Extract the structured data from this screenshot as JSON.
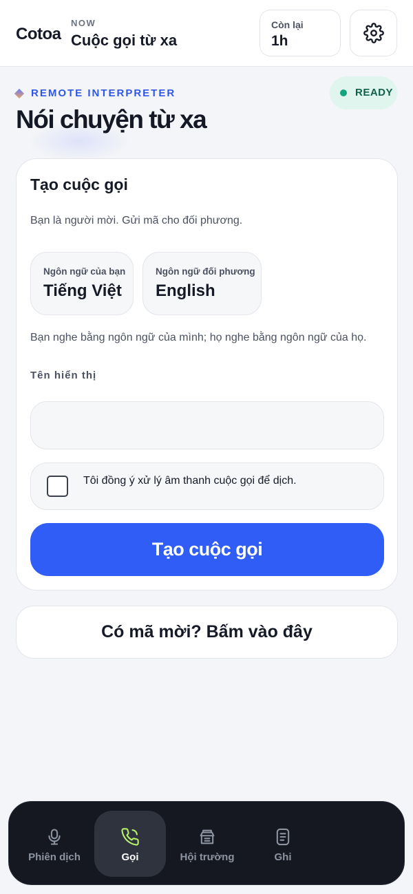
{
  "header": {
    "brand": "Cotoa",
    "now_label": "NOW",
    "title": "Cuộc gọi từ xa",
    "remaining_label": "Còn lại",
    "remaining_value": "1h",
    "settings_icon": "gear-icon"
  },
  "hero": {
    "kicker": "REMOTE INTERPRETER",
    "status": "READY",
    "title": "Nói chuyện từ xa",
    "colors": {
      "accent": "#2f57e8",
      "status_bg": "#dff5ee",
      "status_dot": "#14a37f"
    }
  },
  "create_call": {
    "title": "Tạo cuộc gọi",
    "description": "Bạn là người mời. Gửi mã cho đối phương.",
    "my_language_label": "Ngôn ngữ của bạn",
    "my_language_value": "Tiếng Việt",
    "their_language_label": "Ngôn ngữ đối phương",
    "their_language_value": "English",
    "hint": "Bạn nghe bằng ngôn ngữ của mình; họ nghe bằng ngôn ngữ của họ.",
    "display_name_label": "Tên hiển thị",
    "display_name_value": "",
    "consent_text": "Tôi đồng ý xử lý âm thanh cuộc gọi để dịch.",
    "consent_checked": false,
    "submit_label": "Tạo cuộc gọi",
    "colors": {
      "primary": "#2f5df5"
    }
  },
  "invite": {
    "label": "Có mã mời? Bấm vào đây"
  },
  "nav": {
    "items": [
      {
        "label": "Phiên dịch",
        "icon": "microphone-icon",
        "active": false
      },
      {
        "label": "Gọi",
        "icon": "phone-icon",
        "active": true
      },
      {
        "label": "Hội trường",
        "icon": "podium-icon",
        "active": false
      },
      {
        "label": "Ghi",
        "icon": "notes-icon",
        "active": false
      }
    ],
    "colors": {
      "background": "#151820",
      "active_icon": "#b8f06a"
    }
  }
}
